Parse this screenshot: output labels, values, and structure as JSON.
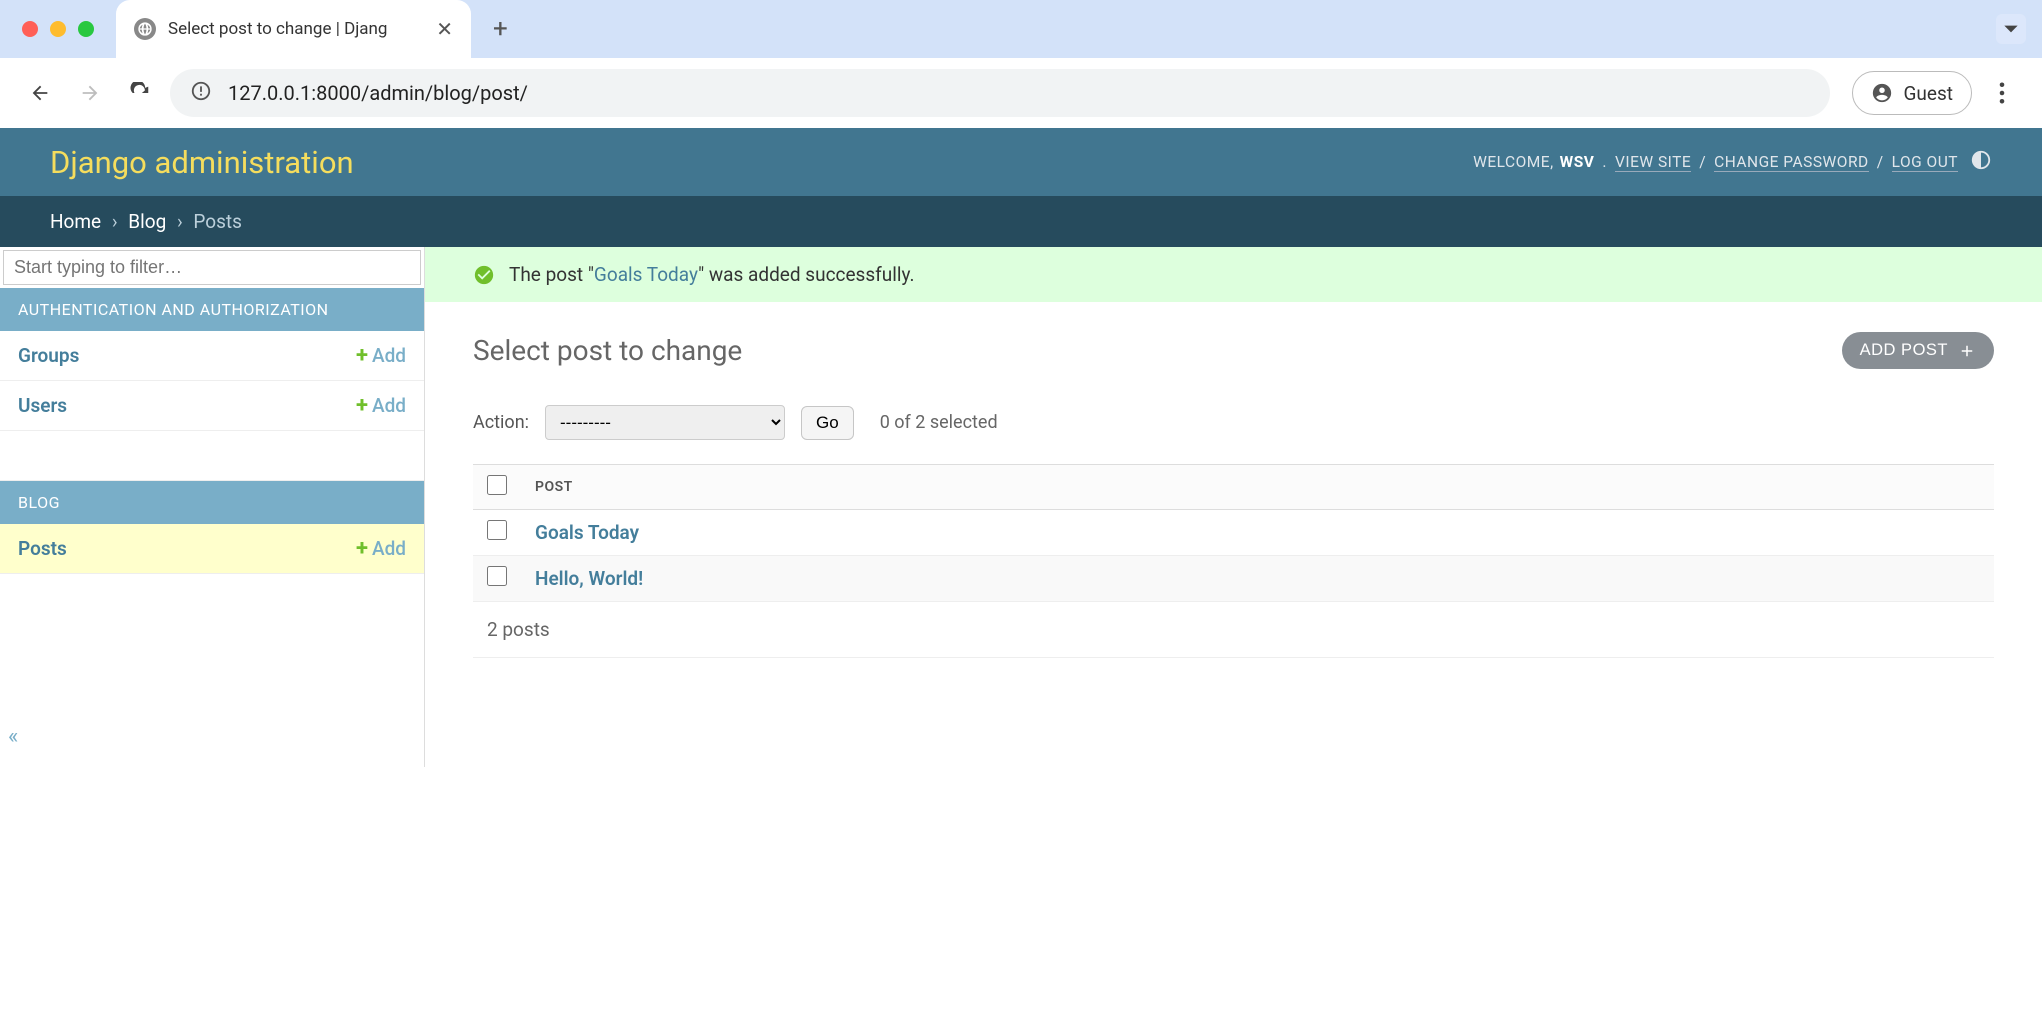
{
  "browser": {
    "tab_title": "Select post to change | Djang",
    "new_tab_label": "+",
    "url": "127.0.0.1:8000/admin/blog/post/",
    "guest_label": "Guest"
  },
  "header": {
    "site_title": "Django administration",
    "welcome_prefix": "WELCOME,",
    "username": "WSV",
    "view_site": "VIEW SITE",
    "change_password": "CHANGE PASSWORD",
    "logout": "LOG OUT"
  },
  "breadcrumbs": {
    "home": "Home",
    "app": "Blog",
    "model": "Posts"
  },
  "sidebar": {
    "filter_placeholder": "Start typing to filter…",
    "apps": [
      {
        "label": "AUTHENTICATION AND AUTHORIZATION",
        "models": [
          {
            "name": "Groups",
            "add_label": "Add",
            "active": false
          },
          {
            "name": "Users",
            "add_label": "Add",
            "active": false
          }
        ]
      },
      {
        "label": "BLOG",
        "models": [
          {
            "name": "Posts",
            "add_label": "Add",
            "active": true
          }
        ]
      }
    ]
  },
  "success": {
    "prefix": "The post \"",
    "link_text": "Goals Today",
    "suffix": "\" was added successfully."
  },
  "main": {
    "heading": "Select post to change",
    "add_button": "ADD POST",
    "action_label": "Action:",
    "action_placeholder": "---------",
    "go_label": "Go",
    "selection_counter": "0 of 2 selected",
    "column_header": "POST",
    "rows": [
      {
        "title": "Goals Today"
      },
      {
        "title": "Hello, World!"
      }
    ],
    "paginator": "2 posts"
  }
}
